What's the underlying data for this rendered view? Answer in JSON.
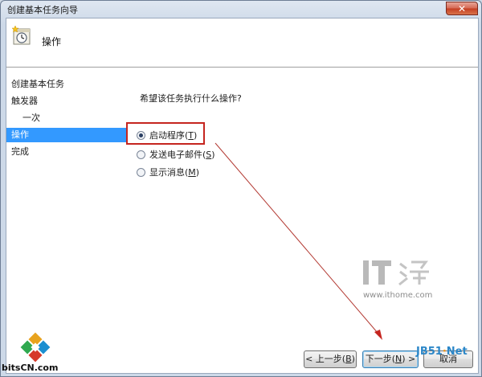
{
  "window": {
    "title": "创建基本任务向导",
    "close_glyph": "✕"
  },
  "header": {
    "title": "操作",
    "icon": "task-clock-icon"
  },
  "sidebar": {
    "items": [
      {
        "label": "创建基本任务",
        "active": false
      },
      {
        "label": "触发器",
        "active": false
      },
      {
        "label": "一次",
        "active": false
      },
      {
        "label": "操作",
        "active": true
      },
      {
        "label": "完成",
        "active": false
      }
    ]
  },
  "content": {
    "question": "希望该任务执行什么操作?",
    "options": [
      {
        "prefix": "启动程序(",
        "key": "T",
        "suffix": ")",
        "checked": true
      },
      {
        "prefix": "发送电子邮件(",
        "key": "S",
        "suffix": ")",
        "checked": false
      },
      {
        "prefix": "显示消息(",
        "key": "M",
        "suffix": ")",
        "checked": false
      }
    ]
  },
  "buttons": {
    "back": {
      "prefix": "< 上一步(",
      "key": "B",
      "suffix": ")"
    },
    "next": {
      "prefix": "下一步(",
      "key": "N",
      "suffix": ") >"
    },
    "cancel": "取消"
  },
  "watermarks": {
    "ithome_url": "www.ithome.com",
    "bitscn": "bitsCN.com",
    "jb51_a": "JB51",
    "jb51_dot": "·",
    "jb51_b": "Net"
  },
  "colors": {
    "accent": "#3399ff",
    "highlight": "#c5251f",
    "arrow": "#b33a33"
  }
}
